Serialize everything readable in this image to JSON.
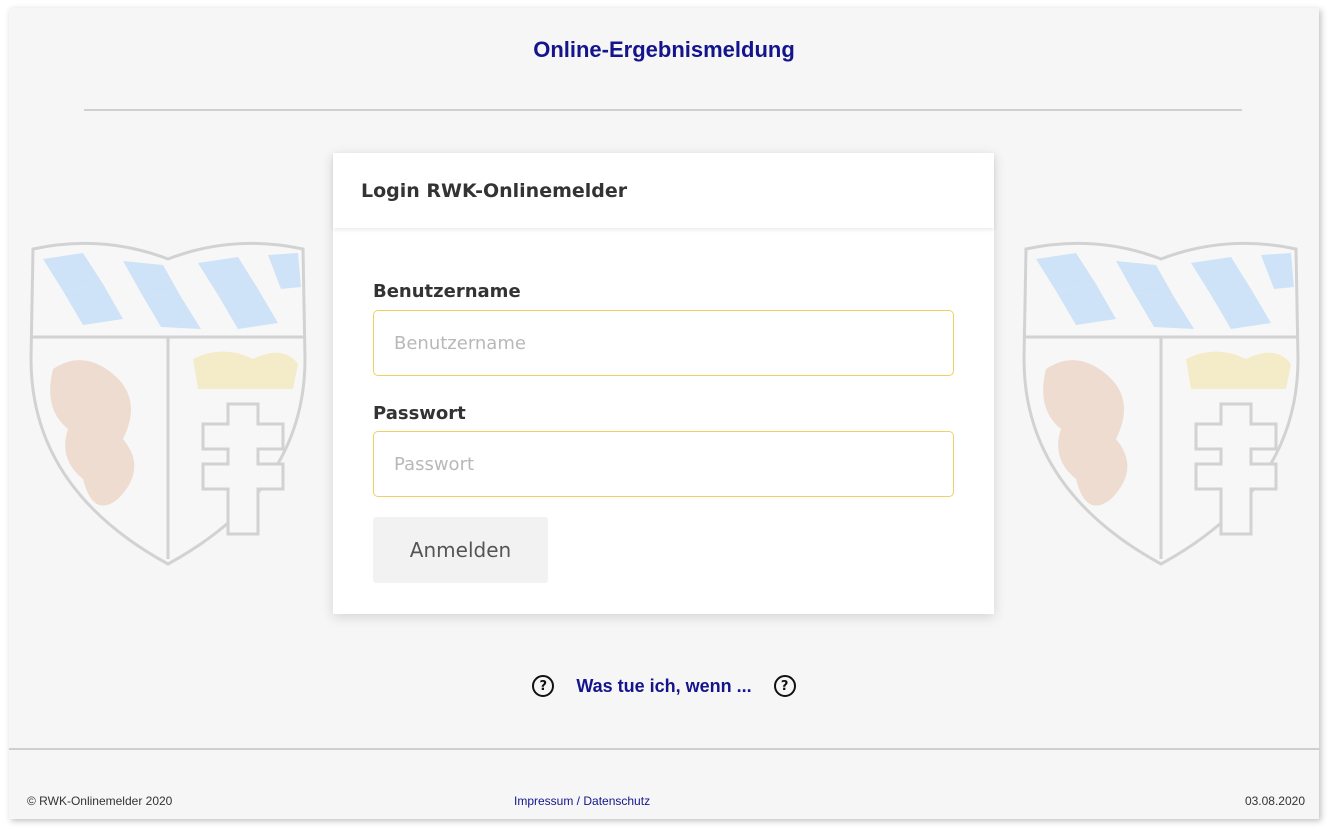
{
  "header": {
    "title": "Online-Ergebnismeldung"
  },
  "login": {
    "title": "Login RWK-Onlinemelder",
    "username_label": "Benutzername",
    "username_placeholder": "Benutzername",
    "username_value": "",
    "password_label": "Passwort",
    "password_placeholder": "Passwort",
    "password_value": "",
    "submit_label": "Anmelden"
  },
  "help": {
    "link_text": "Was tue ich, wenn ...",
    "icon": "question-circle-icon"
  },
  "footer": {
    "copyright": "© RWK-Onlinemelder 2020",
    "impressum": "Impressum",
    "separator": " / ",
    "datenschutz": "Datenschutz",
    "date": "03.08.2020"
  },
  "colors": {
    "title": "#14148c",
    "background": "#f6f6f6",
    "input_border": "#f0d060"
  }
}
